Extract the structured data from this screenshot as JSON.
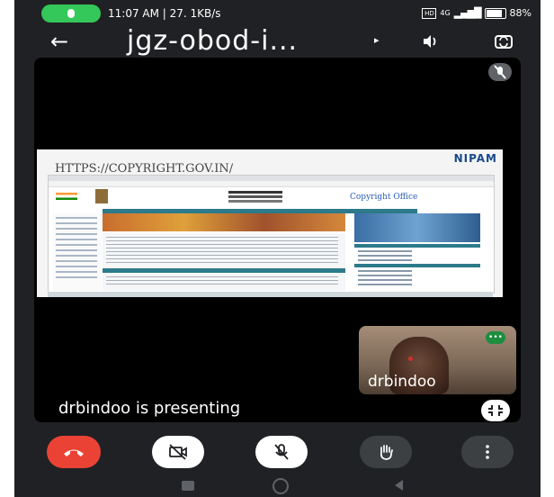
{
  "status_bar": {
    "time_info": "11:07 AM | 27. 1KB/s",
    "network_label": "4G",
    "battery": "88%"
  },
  "title_bar": {
    "meeting_title": "jgz-obod-i..."
  },
  "shared_screen": {
    "url": "HTTPS://COPYRIGHT.GOV.IN/",
    "logo": "NIPAM",
    "site_title": "Copyright Office"
  },
  "self_view": {
    "name": "drbindoo"
  },
  "presenting": {
    "text": "drbindoo is presenting"
  },
  "colors": {
    "end_call": "#ea4335",
    "mic_indicator": "#34c759",
    "self_options": "#1e8e3e",
    "background": "#202124"
  },
  "icons": {
    "back": "arrow-left-icon",
    "speaker": "speaker-icon",
    "camera_switch": "camera-switch-icon",
    "mic_off": "mic-off-icon",
    "camera_off": "camera-off-icon",
    "hand": "raise-hand-icon",
    "more": "more-vert-icon",
    "end_call": "phone-hangup-icon",
    "fullscreen": "fullscreen-exit-icon"
  }
}
